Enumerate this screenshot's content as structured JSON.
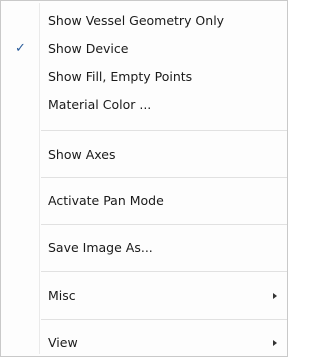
{
  "menu": {
    "items": [
      {
        "label": "Show Vessel Geometry Only",
        "checked": false,
        "submenu": false
      },
      {
        "label": "Show Device",
        "checked": true,
        "submenu": false
      },
      {
        "label": "Show Fill, Empty Points",
        "checked": false,
        "submenu": false
      },
      {
        "label": "Material Color ...",
        "checked": false,
        "submenu": false
      },
      {
        "label": "Show Axes",
        "checked": false,
        "submenu": false
      },
      {
        "label": "Activate Pan Mode",
        "checked": false,
        "submenu": false
      },
      {
        "label": "Save Image As...",
        "checked": false,
        "submenu": false
      },
      {
        "label": "Misc",
        "checked": false,
        "submenu": true
      },
      {
        "label": "View",
        "checked": false,
        "submenu": true
      }
    ],
    "check_glyph": "✓",
    "accent_color": "#2b5d9b"
  }
}
